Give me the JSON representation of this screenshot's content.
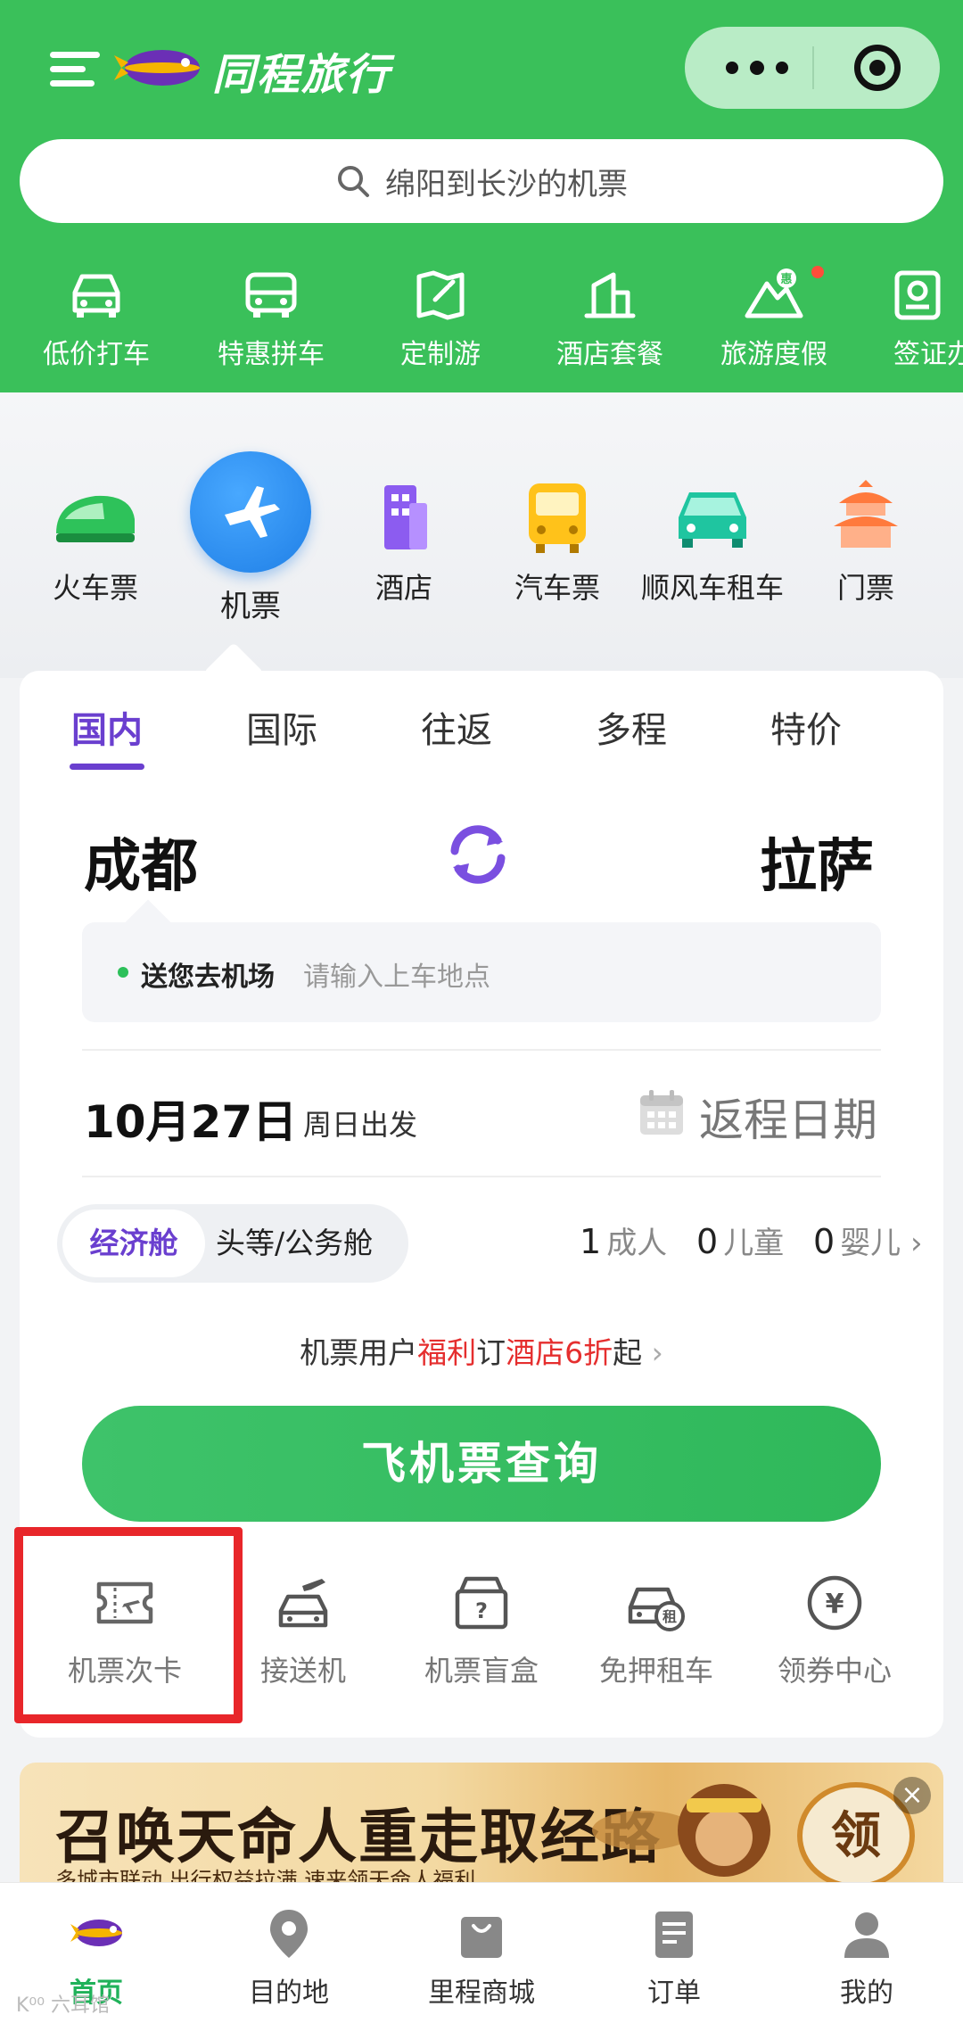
{
  "header": {
    "app_title": "同程旅行",
    "search_placeholder": "绵阳到长沙的机票"
  },
  "quick_services": [
    {
      "label": "低价打车",
      "icon": "car-icon"
    },
    {
      "label": "特惠拼车",
      "icon": "bus-icon"
    },
    {
      "label": "定制游",
      "icon": "map-icon"
    },
    {
      "label": "酒店套餐",
      "icon": "hotel-package-icon"
    },
    {
      "label": "旅游度假",
      "icon": "mountain-icon",
      "badge": "惠"
    },
    {
      "label": "签证办",
      "icon": "visa-icon"
    }
  ],
  "categories": [
    {
      "label": "火车票",
      "icon": "train-icon"
    },
    {
      "label": "机票",
      "icon": "plane-icon",
      "active": true
    },
    {
      "label": "酒店",
      "icon": "building-icon"
    },
    {
      "label": "汽车票",
      "icon": "coach-icon"
    },
    {
      "label": "顺风车租车",
      "icon": "rental-car-icon"
    },
    {
      "label": "门票",
      "icon": "temple-icon"
    }
  ],
  "booking": {
    "tabs": [
      "国内",
      "国际",
      "往返",
      "多程",
      "特价"
    ],
    "active_tab": "国内",
    "from_city": "成都",
    "to_city": "拉萨",
    "pickup_title": "送您去机场",
    "pickup_placeholder": "请输入上车地点",
    "depart_date": "10月27日",
    "depart_day": "周日出发",
    "return_label": "返程日期",
    "cabin_selected": "经济舱",
    "cabin_other": "头等/公务舱",
    "passengers": {
      "adult_count": "1",
      "adult_label": "成人",
      "child_count": "0",
      "child_label": "儿童",
      "infant_count": "0",
      "infant_label": "婴儿"
    },
    "promo": {
      "p1": "机票用户",
      "p2": "福利",
      "p3": "订",
      "p4": "酒店6折",
      "p5": "起"
    },
    "search_button": "飞机票查询"
  },
  "sub_services": [
    {
      "label": "机票次卡",
      "icon": "ticket-card-icon",
      "highlighted": true
    },
    {
      "label": "接送机",
      "icon": "airport-transfer-icon"
    },
    {
      "label": "机票盲盒",
      "icon": "mystery-box-icon"
    },
    {
      "label": "免押租车",
      "icon": "deposit-free-rental-icon"
    },
    {
      "label": "领券中心",
      "icon": "coupon-center-icon"
    }
  ],
  "banner": {
    "title": "召唤天命人重走取经路",
    "subtitle": "多城市联动 出行权益拉满 速来领天命人福利",
    "claim": "领",
    "close": "×"
  },
  "bottom_nav": [
    {
      "label": "首页",
      "icon": "home-blimp-icon",
      "active": true
    },
    {
      "label": "目的地",
      "icon": "location-pin-icon"
    },
    {
      "label": "里程商城",
      "icon": "shopping-bag-icon"
    },
    {
      "label": "订单",
      "icon": "order-icon"
    },
    {
      "label": "我的",
      "icon": "profile-icon"
    }
  ],
  "colors": {
    "brand_green": "#3ac05a",
    "accent_purple": "#6a3fcf",
    "highlight_red": "#e8262a",
    "promo_red": "#e52e2e"
  },
  "watermark": "K⁰⁰ 六耳馆"
}
